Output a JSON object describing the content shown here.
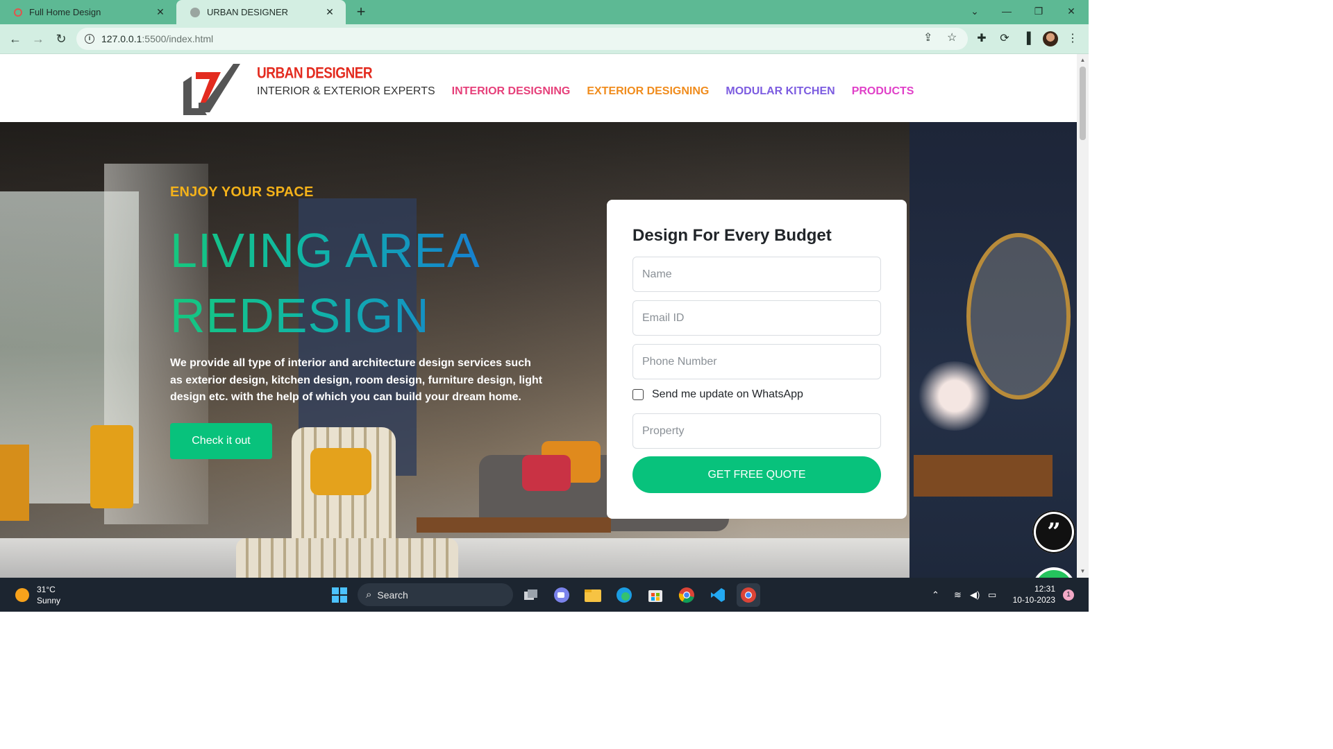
{
  "browser": {
    "tabs": [
      {
        "title": "Full Home Design",
        "close": "✕"
      },
      {
        "title": "URBAN DESIGNER",
        "close": "✕"
      }
    ],
    "new_tab": "+",
    "url_host": "127.0.0.1",
    "url_path": ":5500/index.html",
    "window_controls": {
      "dropdown": "⌄",
      "minimize": "—",
      "restore": "❐",
      "close": "✕"
    }
  },
  "site": {
    "brand": "URBAN DESIGNER",
    "nav": [
      "INTERIOR & EXTERIOR EXPERTS",
      "INTERIOR DESIGNING",
      "EXTERIOR DESIGNING",
      "MODULAR KITCHEN",
      "PRODUCTS"
    ],
    "colors": {
      "brand_red": "#e32b1f",
      "accent_green": "#08c27c",
      "subtitle_yellow": "#f4b21a"
    }
  },
  "hero": {
    "subtitle": "ENJOY YOUR SPACE",
    "title_line1": "LIVING AREA",
    "title_line2": "REDESIGN",
    "description": "We provide all type of interior and architecture design services such as exterior design, kitchen design, room design, furniture design, light design etc. with the help of which you can build your dream home.",
    "cta": "Check it out"
  },
  "form": {
    "title": "Design For Every Budget",
    "name_placeholder": "Name",
    "email_placeholder": "Email ID",
    "phone_placeholder": "Phone Number",
    "whatsapp_label": "Send me update on WhatsApp",
    "whatsapp_checked": false,
    "property_placeholder": "Property",
    "submit": "GET FREE QUOTE"
  },
  "taskbar": {
    "temperature": "31°C",
    "condition": "Sunny",
    "search_label": "Search",
    "time": "12:31",
    "date": "10-10-2023",
    "notification_count": "1"
  }
}
